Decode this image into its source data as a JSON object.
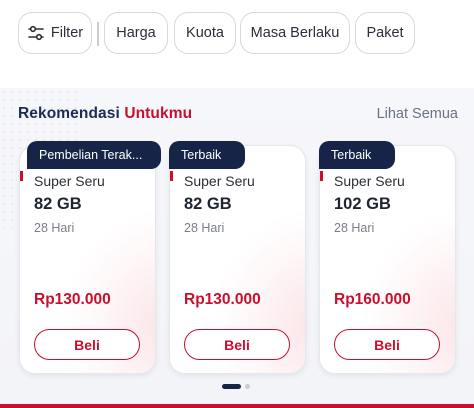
{
  "filters": {
    "filter_label": "Filter",
    "chips": [
      "Harga",
      "Kuota",
      "Masa Berlaku",
      "Paket"
    ]
  },
  "section": {
    "title_part1": "Rekomendasi",
    "title_part2": "Untukmu",
    "see_all": "Lihat Semua"
  },
  "cards": [
    {
      "badge": "Pembelian Terak...",
      "name": "Super Seru",
      "quota": "82 GB",
      "days": "28 Hari",
      "price": "Rp130.000",
      "button": "Beli"
    },
    {
      "badge": "Terbaik",
      "name": "Super Seru",
      "quota": "82 GB",
      "days": "28 Hari",
      "price": "Rp130.000",
      "button": "Beli"
    },
    {
      "badge": "Terbaik",
      "name": "Super Seru",
      "quota": "102 GB",
      "days": "28 Hari",
      "price": "Rp160.000",
      "button": "Beli"
    }
  ],
  "pager": {
    "pages": 2,
    "active": 1
  },
  "colors": {
    "accent": "#c8102e",
    "navy": "#162447",
    "title_navy": "#1d2b55"
  }
}
